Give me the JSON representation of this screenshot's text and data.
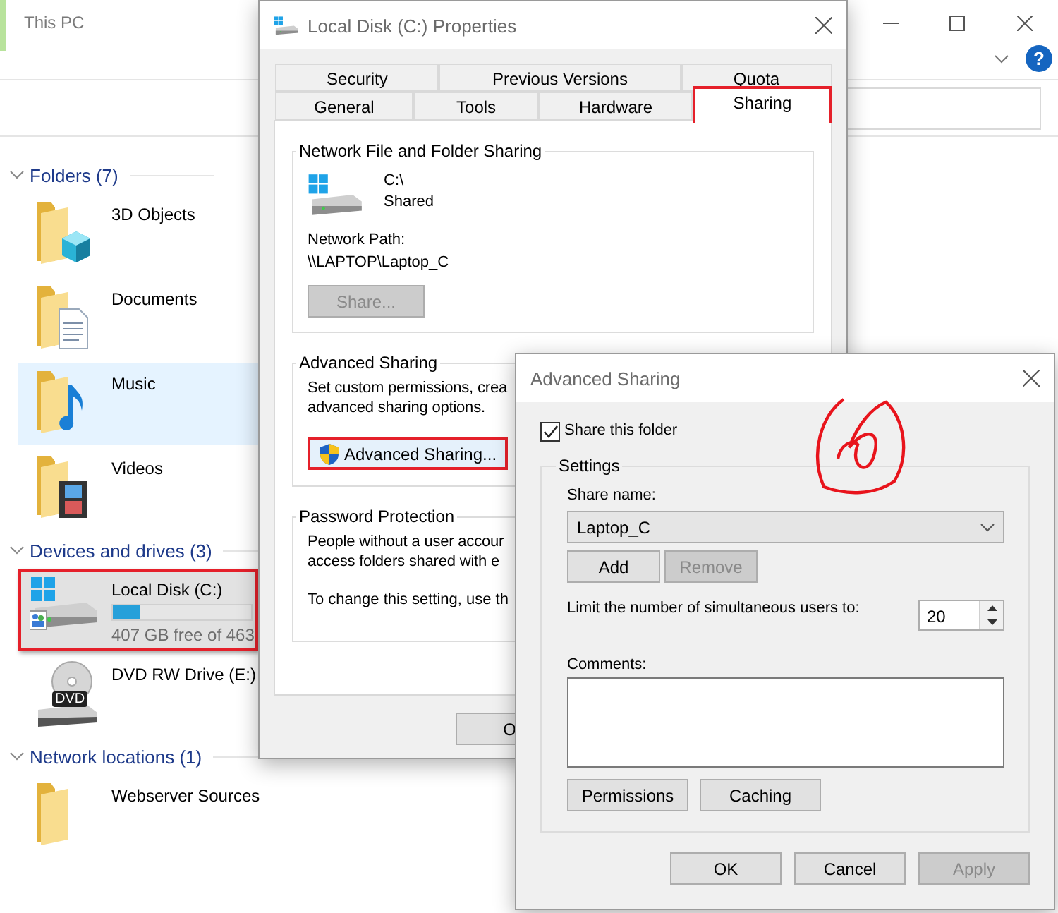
{
  "explorer": {
    "title": "This PC",
    "help": "?",
    "sections": [
      {
        "heading": "Folders (7)",
        "items": [
          {
            "kind": "folder_cube",
            "name": "3D Objects",
            "selected": false,
            "hovered": false,
            "highlighted": false
          },
          {
            "kind": "folder_document",
            "name": "Documents",
            "selected": false,
            "hovered": false,
            "highlighted": false
          },
          {
            "kind": "folder_music",
            "name": "Music",
            "selected": false,
            "hovered": true,
            "highlighted": false
          },
          {
            "kind": "folder_video",
            "name": "Videos",
            "selected": false,
            "hovered": false,
            "highlighted": false
          }
        ]
      },
      {
        "heading": "Devices and drives (3)",
        "items": [
          {
            "kind": "drive",
            "name": "Local Disk (C:)",
            "level": 0.19,
            "detail": "407 GB free of 463",
            "selected": true,
            "hovered": false,
            "highlighted": true
          },
          {
            "kind": "dvd",
            "name": "DVD RW Drive (E:)",
            "badge": "DVD",
            "selected": false,
            "hovered": false,
            "highlighted": false
          }
        ]
      },
      {
        "heading": "Network locations (1)",
        "items": [
          {
            "kind": "folder",
            "name": "Webserver Sources",
            "selected": false,
            "hovered": false,
            "highlighted": false
          }
        ]
      }
    ]
  },
  "properties": {
    "title": "Local Disk (C:) Properties",
    "tabs_back": [
      {
        "label": "Security",
        "selected": false,
        "highlighted": false
      },
      {
        "label": "Previous Versions",
        "selected": false,
        "highlighted": false
      },
      {
        "label": "Quota",
        "selected": false,
        "highlighted": false
      }
    ],
    "tabs_front": [
      {
        "label": "General",
        "selected": false,
        "highlighted": false
      },
      {
        "label": "Tools",
        "selected": false,
        "highlighted": false
      },
      {
        "label": "Hardware",
        "selected": false,
        "highlighted": false
      },
      {
        "label": "Sharing",
        "selected": true,
        "highlighted": true
      }
    ],
    "network_sharing": {
      "heading": "Network File and Folder Sharing",
      "path": "C:\\",
      "status": "Shared",
      "path_label": "Network Path:",
      "network_path": "\\\\LAPTOP\\Laptop_C",
      "share_button": {
        "label": "Share...",
        "disabled": true
      }
    },
    "advanced": {
      "heading": "Advanced Sharing",
      "text_lines": [
        "Set custom permissions, crea",
        "advanced sharing options."
      ],
      "button": {
        "label": "Advanced Sharing...",
        "highlighted": true
      }
    },
    "password": {
      "heading": "Password Protection",
      "text_lines": [
        "People without a user accour",
        "access folders shared with e"
      ],
      "note": "To change this setting, use th"
    },
    "ok_button": "O"
  },
  "advanced_sharing": {
    "title": "Advanced Sharing",
    "share_folder": {
      "label": "Share this folder",
      "checked": true
    },
    "settings": {
      "heading": "Settings",
      "share_name_label": "Share name:",
      "share_name": "Laptop_C",
      "add": {
        "label": "Add",
        "disabled": false
      },
      "remove": {
        "label": "Remove",
        "disabled": true
      },
      "limit_label": "Limit the number of simultaneous users to:",
      "limit": "20",
      "comments_label": "Comments:",
      "permissions": "Permissions",
      "caching": "Caching"
    },
    "buttons": [
      {
        "label": "OK",
        "disabled": false
      },
      {
        "label": "Cancel",
        "disabled": false
      },
      {
        "label": "Apply",
        "disabled": true
      }
    ]
  }
}
